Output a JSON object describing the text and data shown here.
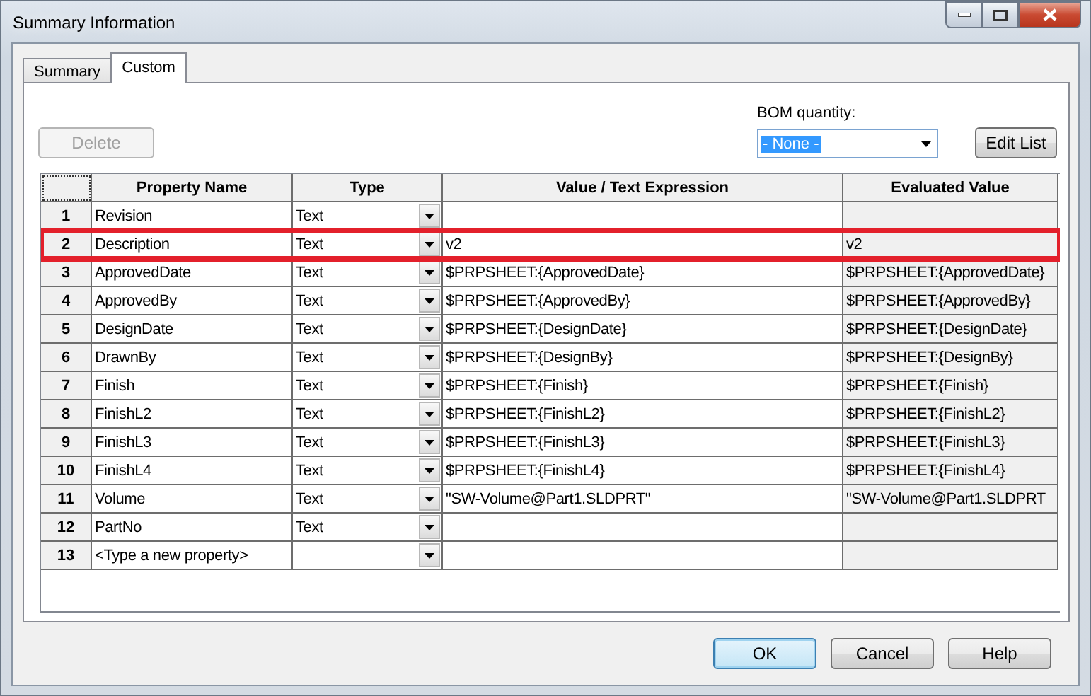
{
  "window": {
    "title": "Summary Information"
  },
  "tabs": [
    {
      "label": "Summary",
      "selected": false
    },
    {
      "label": "Custom",
      "selected": true
    }
  ],
  "delete_button": {
    "label": "Delete",
    "disabled": true
  },
  "bom_quantity": {
    "label": "BOM quantity:",
    "value": "- None -"
  },
  "edit_list_button": {
    "label": "Edit List"
  },
  "table": {
    "columns": [
      "Property Name",
      "Type",
      "Value / Text Expression",
      "Evaluated Value"
    ],
    "rows": [
      {
        "number": "1",
        "name": "Revision",
        "type": "Text",
        "highlighted": false
      },
      {
        "number": "2",
        "name": "Description",
        "type": "Text",
        "value": "v2",
        "evaluated": "v2",
        "highlighted": true
      },
      {
        "number": "3",
        "name": "ApprovedDate",
        "type": "Text",
        "value": "$PRPSHEET:{ApprovedDate}",
        "evaluated": "$PRPSHEET:{ApprovedDate}",
        "highlighted": false
      },
      {
        "number": "4",
        "name": "ApprovedBy",
        "type": "Text",
        "value": "$PRPSHEET:{ApprovedBy}",
        "evaluated": "$PRPSHEET:{ApprovedBy}",
        "highlighted": false
      },
      {
        "number": "5",
        "name": "DesignDate",
        "type": "Text",
        "value": "$PRPSHEET:{DesignDate}",
        "evaluated": "$PRPSHEET:{DesignDate}",
        "highlighted": false
      },
      {
        "number": "6",
        "name": "DrawnBy",
        "type": "Text",
        "value": "$PRPSHEET:{DesignBy}",
        "evaluated": "$PRPSHEET:{DesignBy}",
        "highlighted": false
      },
      {
        "number": "7",
        "name": "Finish",
        "type": "Text",
        "value": "$PRPSHEET:{Finish}",
        "evaluated": "$PRPSHEET:{Finish}",
        "highlighted": false
      },
      {
        "number": "8",
        "name": "FinishL2",
        "type": "Text",
        "value": "$PRPSHEET:{FinishL2}",
        "evaluated": "$PRPSHEET:{FinishL2}",
        "highlighted": false
      },
      {
        "number": "9",
        "name": "FinishL3",
        "type": "Text",
        "value": "$PRPSHEET:{FinishL3}",
        "evaluated": "$PRPSHEET:{FinishL3}",
        "highlighted": false
      },
      {
        "number": "10",
        "name": "FinishL4",
        "type": "Text",
        "value": "$PRPSHEET:{FinishL4}",
        "evaluated": "$PRPSHEET:{FinishL4}",
        "highlighted": false
      },
      {
        "number": "11",
        "name": "Volume",
        "type": "Text",
        "value": "\"SW-Volume@Part1.SLDPRT\"",
        "evaluated": "\"SW-Volume@Part1.SLDPRT",
        "highlighted": false
      },
      {
        "number": "12",
        "name": "PartNo",
        "type": "Text",
        "highlighted": false
      },
      {
        "number": "13",
        "name": "<Type a new property>",
        "highlighted": false
      }
    ]
  },
  "buttons": [
    {
      "label": "OK",
      "default": true
    },
    {
      "label": "Cancel",
      "default": false
    },
    {
      "label": "Help",
      "default": false
    }
  ]
}
